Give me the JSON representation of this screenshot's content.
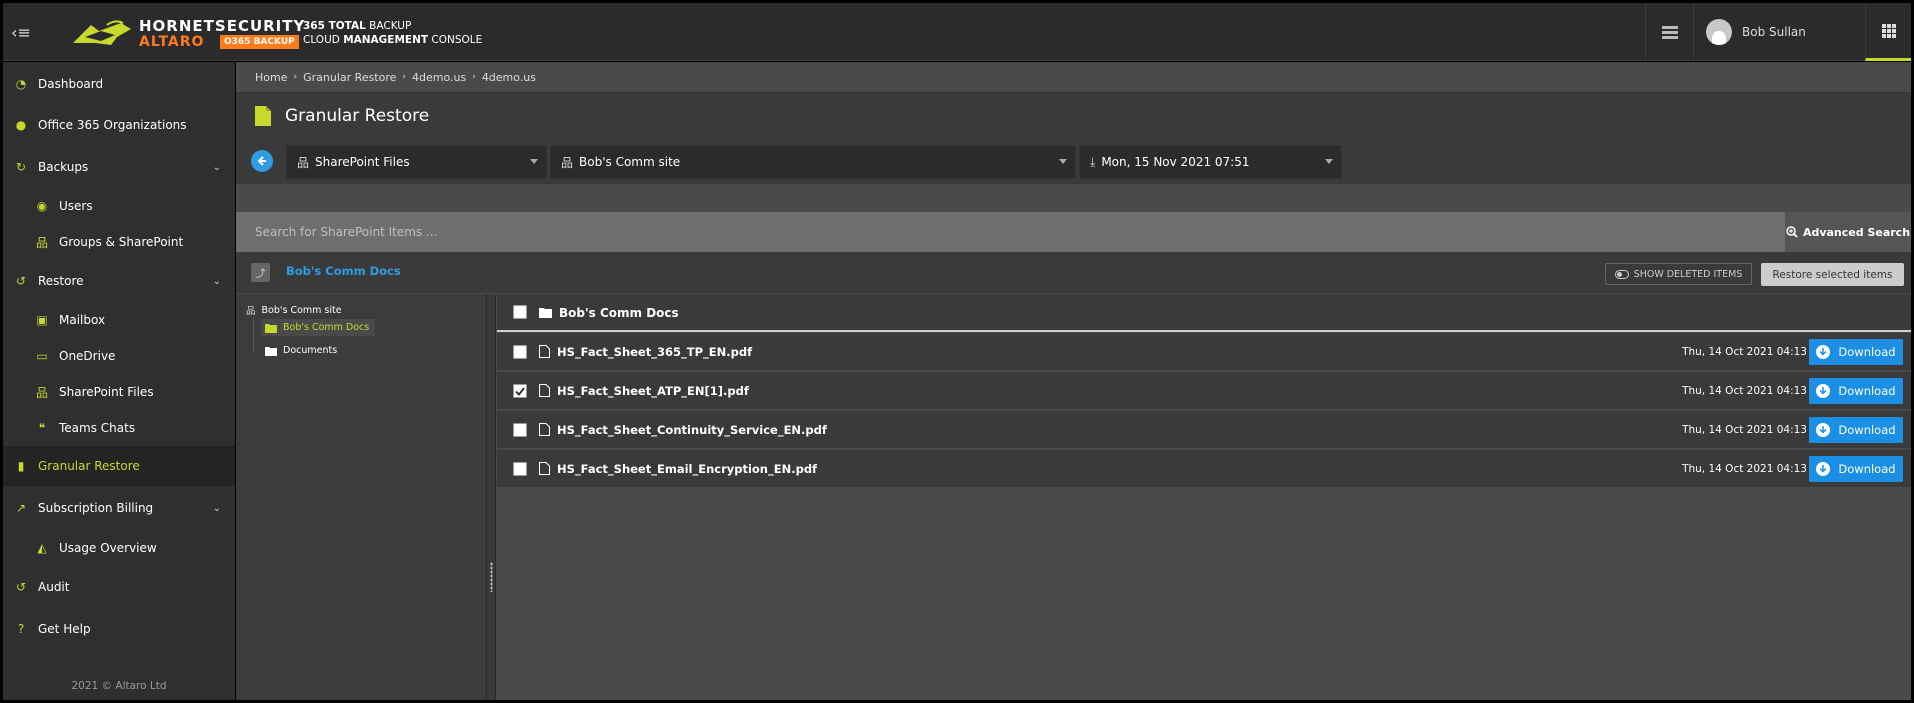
{
  "header": {
    "brand_top": "HORNETSECURITY",
    "brand_bottom": "ALTARO",
    "brand_badge": "O365 BACKUP",
    "product_line1_bold": "365 TOTAL",
    "product_line1": " BACKUP",
    "product_line2_a": "CLOUD ",
    "product_line2_bold": "MANAGEMENT",
    "product_line2_b": " CONSOLE",
    "user_name": "Bob Sullan"
  },
  "sidebar": {
    "items": [
      {
        "label": "Dashboard",
        "icon": "dashboard-icon"
      },
      {
        "label": "Office 365 Organizations",
        "icon": "globe-icon"
      },
      {
        "label": "Backups",
        "icon": "refresh-icon"
      },
      {
        "label": "Users",
        "icon": "user-circle-icon"
      },
      {
        "label": "Groups & SharePoint",
        "icon": "sitemap-icon"
      },
      {
        "label": "Restore",
        "icon": "restore-icon"
      },
      {
        "label": "Mailbox",
        "icon": "mailbox-icon"
      },
      {
        "label": "OneDrive",
        "icon": "drive-icon"
      },
      {
        "label": "SharePoint Files",
        "icon": "sitemap-icon"
      },
      {
        "label": "Teams Chats",
        "icon": "chat-icon"
      },
      {
        "label": "Granular Restore",
        "icon": "file-icon"
      },
      {
        "label": "Subscription Billing",
        "icon": "line-chart-icon"
      },
      {
        "label": "Usage Overview",
        "icon": "area-chart-icon"
      },
      {
        "label": "Audit",
        "icon": "history-icon"
      },
      {
        "label": "Get Help",
        "icon": "help-icon"
      }
    ],
    "copyright": "2021 © Altaro Ltd"
  },
  "breadcrumb": [
    "Home",
    "Granular Restore",
    "4demo.us",
    "4demo.us"
  ],
  "page_title": "Granular Restore",
  "selectors": {
    "type": "SharePoint Files",
    "site": "Bob's Comm site",
    "date": "Mon, 15 Nov 2021 07:51"
  },
  "search": {
    "placeholder": "Search for SharePoint Items ...",
    "advanced_label": "Advanced Search"
  },
  "path": {
    "current": "Bob's Comm Docs",
    "show_deleted_label": "SHOW DELETED ITEMS",
    "restore_selected_label": "Restore selected items"
  },
  "tree": {
    "root": "Bob's Comm site",
    "children": [
      "Bob's Comm Docs",
      "Documents"
    ]
  },
  "files": {
    "folder_name": "Bob's Comm Docs",
    "download_label": "Download",
    "rows": [
      {
        "name": "HS_Fact_Sheet_365_TP_EN.pdf",
        "date": "Thu, 14 Oct 2021 04:13",
        "checked": false
      },
      {
        "name": "HS_Fact_Sheet_ATP_EN[1].pdf",
        "date": "Thu, 14 Oct 2021 04:13",
        "checked": true
      },
      {
        "name": "HS_Fact_Sheet_Continuity_Service_EN.pdf",
        "date": "Thu, 14 Oct 2021 04:13",
        "checked": false
      },
      {
        "name": "HS_Fact_Sheet_Email_Encryption_EN.pdf",
        "date": "Thu, 14 Oct 2021 04:13",
        "checked": false
      }
    ]
  },
  "colors": {
    "accent": "#c8d82d",
    "brand_orange": "#ff7a1a",
    "link_blue": "#2e9de4",
    "button_blue": "#1a8fe3"
  }
}
